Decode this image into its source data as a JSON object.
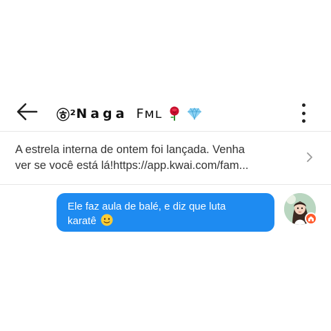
{
  "header": {
    "title_prefix": "㉭²",
    "title_name": "Naga",
    "title_tag": "Fᴍʟ",
    "back_icon": "arrow-left-icon",
    "more_icon": "vertical-dots-icon",
    "decor_icons": [
      "rose-icon",
      "diamond-icon"
    ]
  },
  "notice": {
    "line1": "A estrela interna de ontem foi lançada. Venha",
    "line2": "ver se você está lá!https://app.kwai.com/fam...",
    "icon": "chevron-right-icon"
  },
  "messages": [
    {
      "line1": "Ele faz aula de balé, e diz que luta",
      "line2": "karatê",
      "emoji": "smiling-face-with-tear-icon",
      "bubble_color": "#1e8bf1"
    }
  ],
  "colors": {
    "bubble": "#1e8bf1",
    "badge": "#ff5a2c",
    "divider": "#e6e6e6"
  }
}
